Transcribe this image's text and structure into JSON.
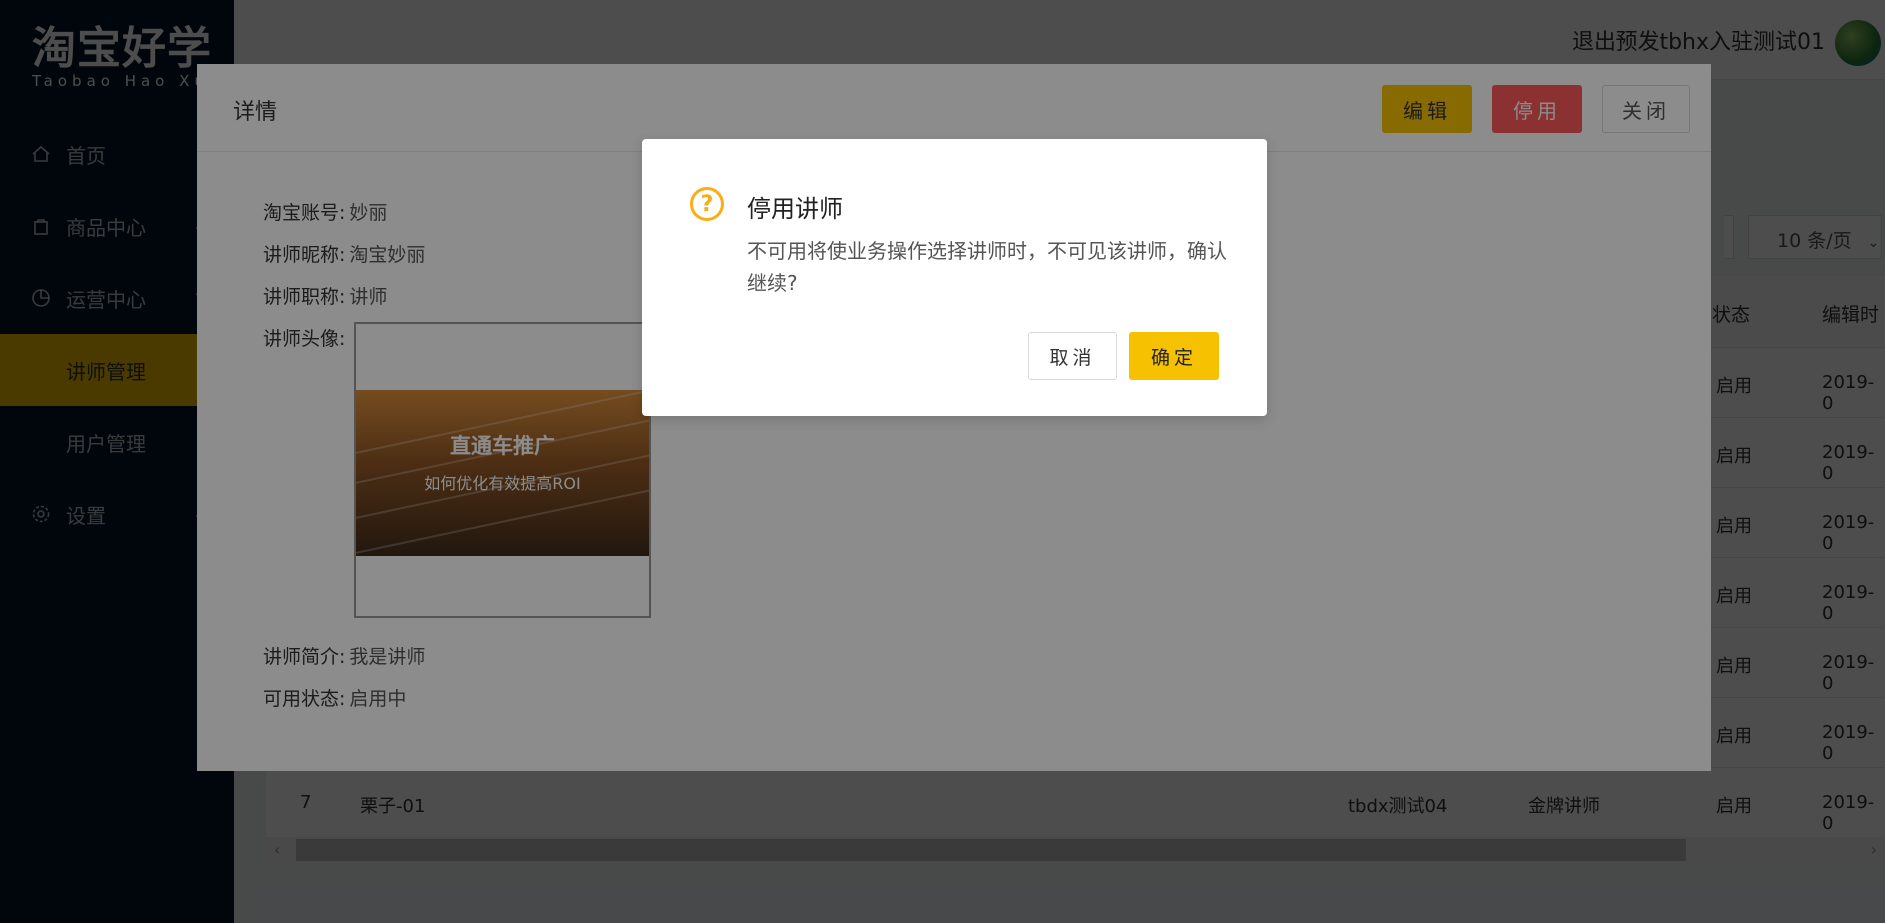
{
  "logo": {
    "cn": "淘宝好学",
    "en": "Taobao Hao Xue"
  },
  "sidebar": {
    "items": [
      {
        "label": "首页"
      },
      {
        "label": "商品中心"
      },
      {
        "label": "运营中心"
      },
      {
        "label": "讲师管理"
      },
      {
        "label": "用户管理"
      },
      {
        "label": "设置"
      }
    ]
  },
  "header": {
    "logout": "退出",
    "username": "预发tbhx入驻测试01"
  },
  "list": {
    "page_size": "10 条/页",
    "columns": {
      "status": "状态",
      "edit_time": "编辑时"
    },
    "rows": [
      {
        "status": "启用",
        "time": "2019-0"
      },
      {
        "status": "启用",
        "time": "2019-0"
      },
      {
        "status": "启用",
        "time": "2019-0"
      },
      {
        "status": "启用",
        "time": "2019-0"
      },
      {
        "status": "启用",
        "time": "2019-0"
      },
      {
        "status": "启用",
        "time": "2019-0"
      },
      {
        "index": "7",
        "name": "栗子-01",
        "account": "tbdx测试04",
        "title": "金牌讲师",
        "status": "启用",
        "time": "2019-0"
      }
    ]
  },
  "drawer": {
    "title": "详情",
    "edit_label": "编辑",
    "disable_label": "停用",
    "close_label": "关闭",
    "fields": {
      "account_label": "淘宝账号:",
      "account_value": "妙丽",
      "nickname_label": "讲师昵称:",
      "nickname_value": "淘宝妙丽",
      "title_label": "讲师职称:",
      "title_value": "讲师",
      "avatar_label": "讲师头像:",
      "intro_label": "讲师简介:",
      "intro_value": "我是讲师",
      "state_label": "可用状态:",
      "state_value": "启用中"
    },
    "photo": {
      "line1": "直通车推广",
      "line2": "如何优化有效提高ROI"
    }
  },
  "modal": {
    "title": "停用讲师",
    "content": "不可用将使业务操作选择讲师时，不可见该讲师，确认继续?",
    "cancel_label": "取消",
    "ok_label": "确定"
  },
  "icons": {
    "warning_color": "#faad14",
    "brand_color": "#f6c100",
    "danger_color": "#ff5a5a"
  }
}
